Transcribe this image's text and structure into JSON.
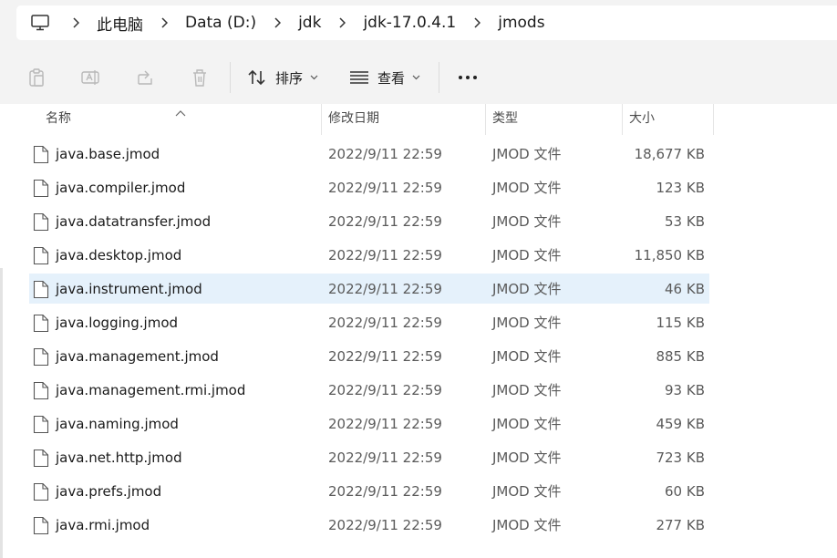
{
  "breadcrumb": [
    "此电脑",
    "Data (D:)",
    "jdk",
    "jdk-17.0.4.1",
    "jmods"
  ],
  "toolbar": {
    "sort_label": "排序",
    "view_label": "查看"
  },
  "columns": {
    "name": "名称",
    "date": "修改日期",
    "type": "类型",
    "size": "大小"
  },
  "files": [
    {
      "name": "java.base.jmod",
      "date": "2022/9/11 22:59",
      "type": "JMOD 文件",
      "size": "18,677 KB"
    },
    {
      "name": "java.compiler.jmod",
      "date": "2022/9/11 22:59",
      "type": "JMOD 文件",
      "size": "123 KB"
    },
    {
      "name": "java.datatransfer.jmod",
      "date": "2022/9/11 22:59",
      "type": "JMOD 文件",
      "size": "53 KB"
    },
    {
      "name": "java.desktop.jmod",
      "date": "2022/9/11 22:59",
      "type": "JMOD 文件",
      "size": "11,850 KB"
    },
    {
      "name": "java.instrument.jmod",
      "date": "2022/9/11 22:59",
      "type": "JMOD 文件",
      "size": "46 KB",
      "selected": true
    },
    {
      "name": "java.logging.jmod",
      "date": "2022/9/11 22:59",
      "type": "JMOD 文件",
      "size": "115 KB"
    },
    {
      "name": "java.management.jmod",
      "date": "2022/9/11 22:59",
      "type": "JMOD 文件",
      "size": "885 KB"
    },
    {
      "name": "java.management.rmi.jmod",
      "date": "2022/9/11 22:59",
      "type": "JMOD 文件",
      "size": "93 KB"
    },
    {
      "name": "java.naming.jmod",
      "date": "2022/9/11 22:59",
      "type": "JMOD 文件",
      "size": "459 KB"
    },
    {
      "name": "java.net.http.jmod",
      "date": "2022/9/11 22:59",
      "type": "JMOD 文件",
      "size": "723 KB"
    },
    {
      "name": "java.prefs.jmod",
      "date": "2022/9/11 22:59",
      "type": "JMOD 文件",
      "size": "60 KB"
    },
    {
      "name": "java.rmi.jmod",
      "date": "2022/9/11 22:59",
      "type": "JMOD 文件",
      "size": "277 KB"
    }
  ],
  "colors": {
    "selected_row": "#e5f1fb",
    "accent": "#005fb8"
  }
}
